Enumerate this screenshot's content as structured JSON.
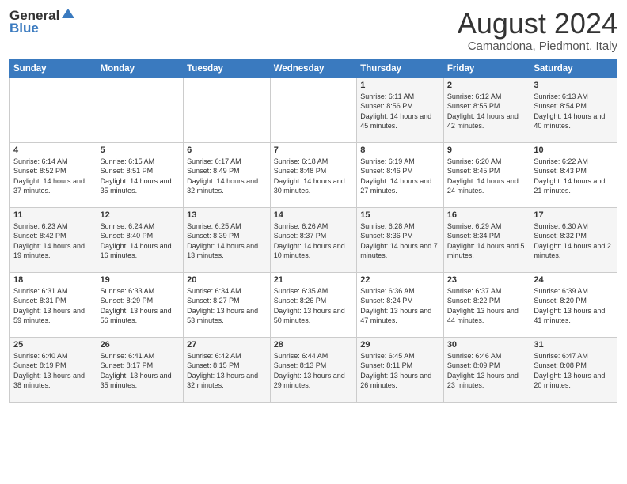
{
  "header": {
    "logo_general": "General",
    "logo_blue": "Blue",
    "month_title": "August 2024",
    "location": "Camandona, Piedmont, Italy"
  },
  "days_of_week": [
    "Sunday",
    "Monday",
    "Tuesday",
    "Wednesday",
    "Thursday",
    "Friday",
    "Saturday"
  ],
  "weeks": [
    [
      {
        "day": "",
        "sunrise": "",
        "sunset": "",
        "daylight": ""
      },
      {
        "day": "",
        "sunrise": "",
        "sunset": "",
        "daylight": ""
      },
      {
        "day": "",
        "sunrise": "",
        "sunset": "",
        "daylight": ""
      },
      {
        "day": "",
        "sunrise": "",
        "sunset": "",
        "daylight": ""
      },
      {
        "day": "1",
        "sunrise": "Sunrise: 6:11 AM",
        "sunset": "Sunset: 8:56 PM",
        "daylight": "Daylight: 14 hours and 45 minutes."
      },
      {
        "day": "2",
        "sunrise": "Sunrise: 6:12 AM",
        "sunset": "Sunset: 8:55 PM",
        "daylight": "Daylight: 14 hours and 42 minutes."
      },
      {
        "day": "3",
        "sunrise": "Sunrise: 6:13 AM",
        "sunset": "Sunset: 8:54 PM",
        "daylight": "Daylight: 14 hours and 40 minutes."
      }
    ],
    [
      {
        "day": "4",
        "sunrise": "Sunrise: 6:14 AM",
        "sunset": "Sunset: 8:52 PM",
        "daylight": "Daylight: 14 hours and 37 minutes."
      },
      {
        "day": "5",
        "sunrise": "Sunrise: 6:15 AM",
        "sunset": "Sunset: 8:51 PM",
        "daylight": "Daylight: 14 hours and 35 minutes."
      },
      {
        "day": "6",
        "sunrise": "Sunrise: 6:17 AM",
        "sunset": "Sunset: 8:49 PM",
        "daylight": "Daylight: 14 hours and 32 minutes."
      },
      {
        "day": "7",
        "sunrise": "Sunrise: 6:18 AM",
        "sunset": "Sunset: 8:48 PM",
        "daylight": "Daylight: 14 hours and 30 minutes."
      },
      {
        "day": "8",
        "sunrise": "Sunrise: 6:19 AM",
        "sunset": "Sunset: 8:46 PM",
        "daylight": "Daylight: 14 hours and 27 minutes."
      },
      {
        "day": "9",
        "sunrise": "Sunrise: 6:20 AM",
        "sunset": "Sunset: 8:45 PM",
        "daylight": "Daylight: 14 hours and 24 minutes."
      },
      {
        "day": "10",
        "sunrise": "Sunrise: 6:22 AM",
        "sunset": "Sunset: 8:43 PM",
        "daylight": "Daylight: 14 hours and 21 minutes."
      }
    ],
    [
      {
        "day": "11",
        "sunrise": "Sunrise: 6:23 AM",
        "sunset": "Sunset: 8:42 PM",
        "daylight": "Daylight: 14 hours and 19 minutes."
      },
      {
        "day": "12",
        "sunrise": "Sunrise: 6:24 AM",
        "sunset": "Sunset: 8:40 PM",
        "daylight": "Daylight: 14 hours and 16 minutes."
      },
      {
        "day": "13",
        "sunrise": "Sunrise: 6:25 AM",
        "sunset": "Sunset: 8:39 PM",
        "daylight": "Daylight: 14 hours and 13 minutes."
      },
      {
        "day": "14",
        "sunrise": "Sunrise: 6:26 AM",
        "sunset": "Sunset: 8:37 PM",
        "daylight": "Daylight: 14 hours and 10 minutes."
      },
      {
        "day": "15",
        "sunrise": "Sunrise: 6:28 AM",
        "sunset": "Sunset: 8:36 PM",
        "daylight": "Daylight: 14 hours and 7 minutes."
      },
      {
        "day": "16",
        "sunrise": "Sunrise: 6:29 AM",
        "sunset": "Sunset: 8:34 PM",
        "daylight": "Daylight: 14 hours and 5 minutes."
      },
      {
        "day": "17",
        "sunrise": "Sunrise: 6:30 AM",
        "sunset": "Sunset: 8:32 PM",
        "daylight": "Daylight: 14 hours and 2 minutes."
      }
    ],
    [
      {
        "day": "18",
        "sunrise": "Sunrise: 6:31 AM",
        "sunset": "Sunset: 8:31 PM",
        "daylight": "Daylight: 13 hours and 59 minutes."
      },
      {
        "day": "19",
        "sunrise": "Sunrise: 6:33 AM",
        "sunset": "Sunset: 8:29 PM",
        "daylight": "Daylight: 13 hours and 56 minutes."
      },
      {
        "day": "20",
        "sunrise": "Sunrise: 6:34 AM",
        "sunset": "Sunset: 8:27 PM",
        "daylight": "Daylight: 13 hours and 53 minutes."
      },
      {
        "day": "21",
        "sunrise": "Sunrise: 6:35 AM",
        "sunset": "Sunset: 8:26 PM",
        "daylight": "Daylight: 13 hours and 50 minutes."
      },
      {
        "day": "22",
        "sunrise": "Sunrise: 6:36 AM",
        "sunset": "Sunset: 8:24 PM",
        "daylight": "Daylight: 13 hours and 47 minutes."
      },
      {
        "day": "23",
        "sunrise": "Sunrise: 6:37 AM",
        "sunset": "Sunset: 8:22 PM",
        "daylight": "Daylight: 13 hours and 44 minutes."
      },
      {
        "day": "24",
        "sunrise": "Sunrise: 6:39 AM",
        "sunset": "Sunset: 8:20 PM",
        "daylight": "Daylight: 13 hours and 41 minutes."
      }
    ],
    [
      {
        "day": "25",
        "sunrise": "Sunrise: 6:40 AM",
        "sunset": "Sunset: 8:19 PM",
        "daylight": "Daylight: 13 hours and 38 minutes."
      },
      {
        "day": "26",
        "sunrise": "Sunrise: 6:41 AM",
        "sunset": "Sunset: 8:17 PM",
        "daylight": "Daylight: 13 hours and 35 minutes."
      },
      {
        "day": "27",
        "sunrise": "Sunrise: 6:42 AM",
        "sunset": "Sunset: 8:15 PM",
        "daylight": "Daylight: 13 hours and 32 minutes."
      },
      {
        "day": "28",
        "sunrise": "Sunrise: 6:44 AM",
        "sunset": "Sunset: 8:13 PM",
        "daylight": "Daylight: 13 hours and 29 minutes."
      },
      {
        "day": "29",
        "sunrise": "Sunrise: 6:45 AM",
        "sunset": "Sunset: 8:11 PM",
        "daylight": "Daylight: 13 hours and 26 minutes."
      },
      {
        "day": "30",
        "sunrise": "Sunrise: 6:46 AM",
        "sunset": "Sunset: 8:09 PM",
        "daylight": "Daylight: 13 hours and 23 minutes."
      },
      {
        "day": "31",
        "sunrise": "Sunrise: 6:47 AM",
        "sunset": "Sunset: 8:08 PM",
        "daylight": "Daylight: 13 hours and 20 minutes."
      }
    ]
  ]
}
